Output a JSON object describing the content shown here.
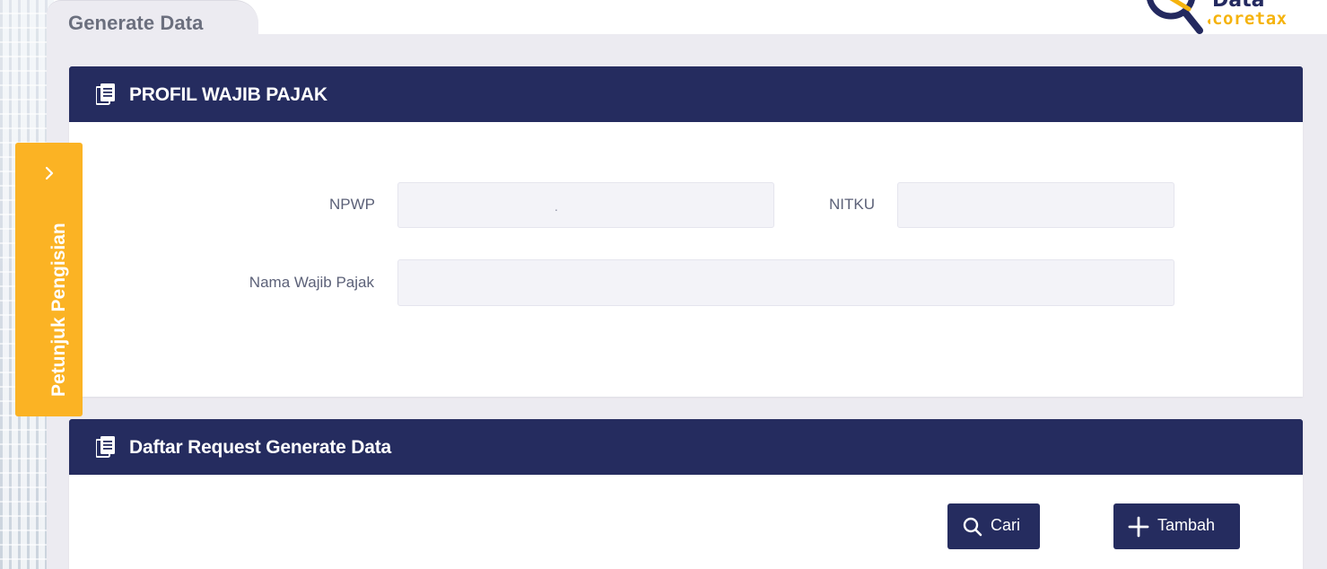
{
  "header": {
    "tab_title": "Generate Data",
    "logo_top": "Data",
    "logo_text": "coretax",
    "logo_color": "#f5b30d"
  },
  "side_panel": {
    "label": "Petunjuk Pengisian",
    "icon": "chevron-right-icon",
    "color": "#fbb324"
  },
  "profile_card": {
    "title": "PROFIL WAJIB PAJAK",
    "icon": "document-icon",
    "fields": {
      "npwp_label": "NPWP",
      "npwp_value": ".",
      "nitku_label": "NITKU",
      "nitku_value": "",
      "nama_label": "Nama Wajib Pajak",
      "nama_value": ""
    }
  },
  "request_card": {
    "title": "Daftar Request Generate Data",
    "icon": "document-icon",
    "search_button": "Cari",
    "add_button": "Tambah"
  },
  "colors": {
    "header_bg": "#252c5f",
    "page_bg": "#ecebf1",
    "field_bg": "#f3f3f8"
  }
}
